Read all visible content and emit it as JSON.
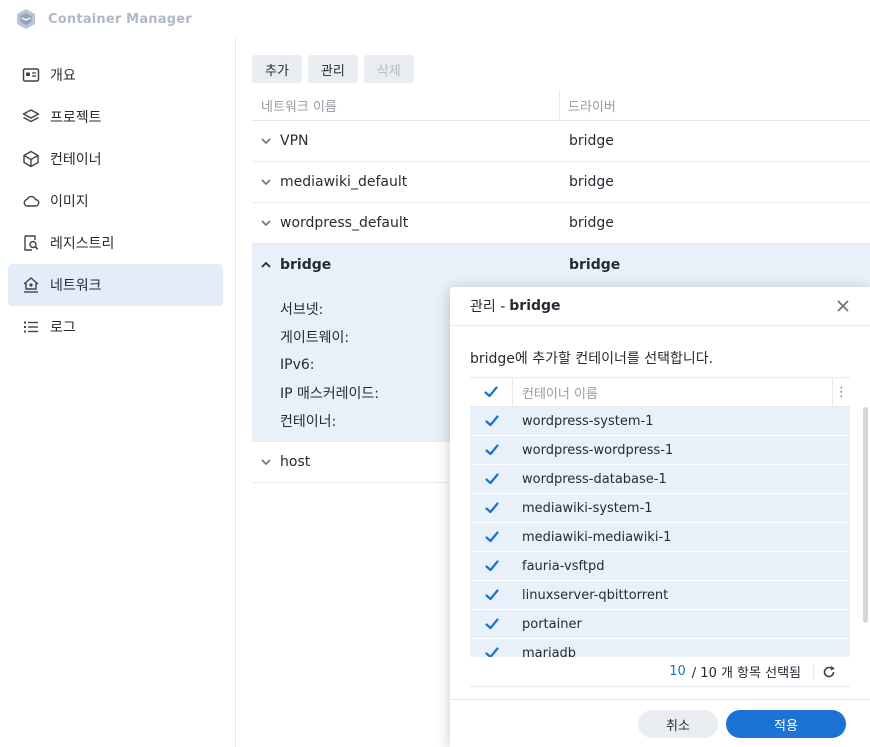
{
  "app": {
    "title": "Container Manager",
    "logo_icon": "container-manager-logo-icon"
  },
  "sidebar": {
    "items": [
      {
        "label": "개요",
        "icon": "overview-icon"
      },
      {
        "label": "프로젝트",
        "icon": "layers-icon"
      },
      {
        "label": "컨테이너",
        "icon": "cube-icon"
      },
      {
        "label": "이미지",
        "icon": "cloud-icon"
      },
      {
        "label": "레지스트리",
        "icon": "registry-search-icon"
      },
      {
        "label": "네트워크",
        "icon": "network-home-icon",
        "active": true
      },
      {
        "label": "로그",
        "icon": "log-list-icon"
      }
    ]
  },
  "toolbar": {
    "add": "추가",
    "manage": "관리",
    "delete": "삭제"
  },
  "network_table": {
    "columns": [
      "네트워크 이름",
      "드라이버"
    ],
    "rows": [
      {
        "name": "VPN",
        "driver": "bridge"
      },
      {
        "name": "mediawiki_default",
        "driver": "bridge"
      },
      {
        "name": "wordpress_default",
        "driver": "bridge"
      },
      {
        "name": "bridge",
        "driver": "bridge",
        "expanded": true
      },
      {
        "name": "host",
        "driver": ""
      }
    ],
    "detail_labels": [
      "서브넷:",
      "게이트웨이:",
      "IPv6:",
      "IP 매스커레이드:",
      "컨테이너:"
    ]
  },
  "dialog": {
    "title_prefix": "관리 -",
    "title_network": "bridge",
    "description": "bridge에 추가할 컨테이너를 선택합니다.",
    "column_name": "컨테이너 이름",
    "more": "⋮",
    "containers": [
      {
        "name": "wordpress-system-1",
        "checked": true
      },
      {
        "name": "wordpress-wordpress-1",
        "checked": true
      },
      {
        "name": "wordpress-database-1",
        "checked": true
      },
      {
        "name": "mediawiki-system-1",
        "checked": true
      },
      {
        "name": "mediawiki-mediawiki-1",
        "checked": true
      },
      {
        "name": "fauria-vsftpd",
        "checked": true
      },
      {
        "name": "linuxserver-qbittorrent",
        "checked": true
      },
      {
        "name": "portainer",
        "checked": true
      },
      {
        "name": "mariadb",
        "checked": true
      }
    ],
    "selected_count": "10",
    "total_text": "/ 10 개 항목 선택됨",
    "cancel": "취소",
    "apply": "적용"
  },
  "colors": {
    "accent": "#1b74d4",
    "checkbox": "#1a73c7",
    "row_selected": "#e8f0f9",
    "active_nav": "#e3edf8"
  }
}
